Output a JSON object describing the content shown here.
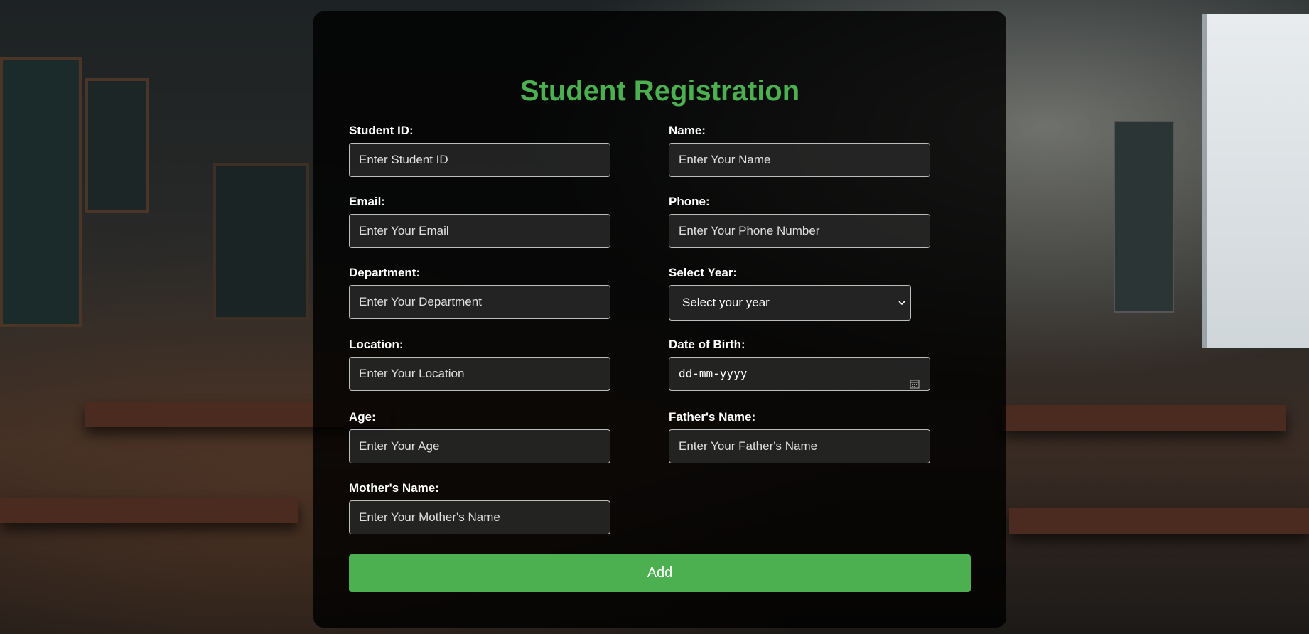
{
  "form": {
    "title": "Student Registration",
    "fields": {
      "student_id": {
        "label": "Student ID:",
        "placeholder": "Enter Student ID"
      },
      "name": {
        "label": "Name:",
        "placeholder": "Enter Your Name"
      },
      "email": {
        "label": "Email:",
        "placeholder": "Enter Your Email"
      },
      "phone": {
        "label": "Phone:",
        "placeholder": "Enter Your Phone Number"
      },
      "department": {
        "label": "Department:",
        "placeholder": "Enter Your Department"
      },
      "year": {
        "label": "Select Year:",
        "selected": "Select your year"
      },
      "location": {
        "label": "Location:",
        "placeholder": "Enter Your Location"
      },
      "dob": {
        "label": "Date of Birth:",
        "placeholder": "dd-mm-yyyy"
      },
      "age": {
        "label": "Age:",
        "placeholder": "Enter Your Age"
      },
      "father_name": {
        "label": "Father's Name:",
        "placeholder": "Enter Your Father's Name"
      },
      "mother_name": {
        "label": "Mother's Name:",
        "placeholder": "Enter Your Mother's Name"
      }
    },
    "submit_label": "Add"
  },
  "colors": {
    "accent": "#4caf50",
    "card_background": "#000000",
    "text": "#ffffff"
  },
  "icons": {
    "select": "chevron-down-icon",
    "date": "calendar-icon"
  }
}
